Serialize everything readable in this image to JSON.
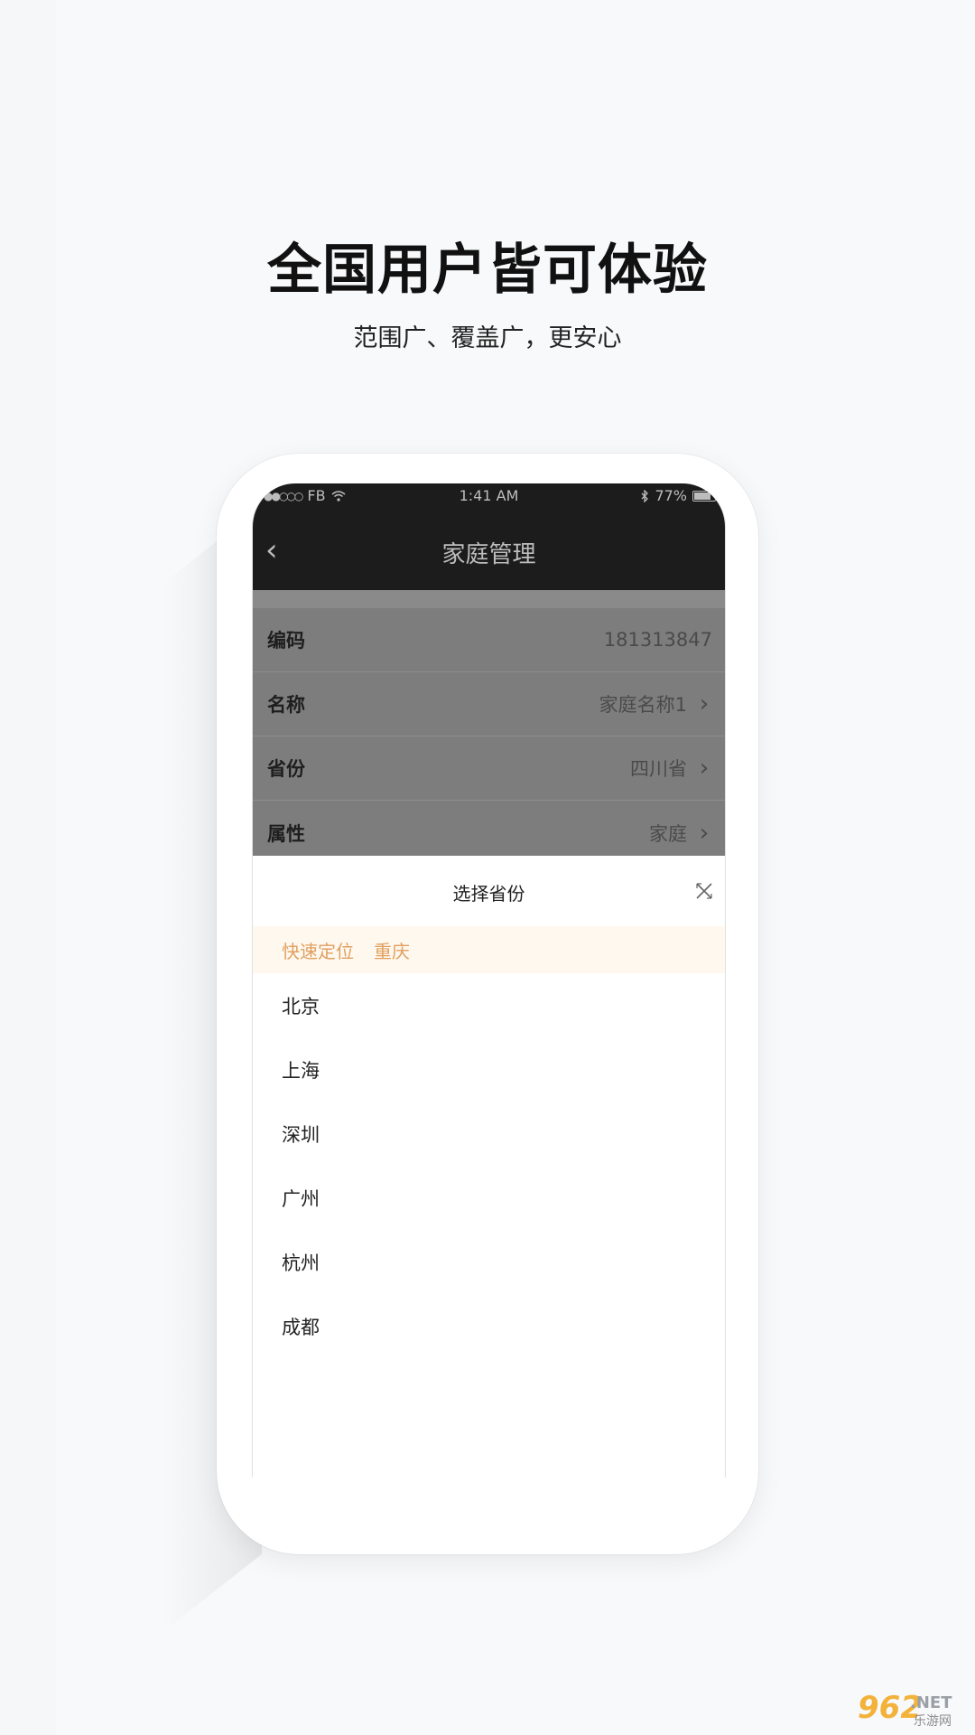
{
  "promo": {
    "headline": "全国用户皆可体验",
    "subline": "范围广、覆盖广，更安心"
  },
  "statusbar": {
    "carrier": "FB",
    "time": "1:41 AM",
    "battery": "77%"
  },
  "navbar": {
    "back_glyph": "‹",
    "title": "家庭管理"
  },
  "form": {
    "rows": [
      {
        "label": "编码",
        "value": "181313847"
      },
      {
        "label": "名称",
        "value": "家庭名称1"
      },
      {
        "label": "省份",
        "value": "四川省"
      },
      {
        "label": "属性",
        "value": "家庭"
      }
    ]
  },
  "sheet": {
    "title": "选择省份",
    "quick_label": "快速定位",
    "quick_city": "重庆",
    "cities": [
      "北京",
      "上海",
      "深圳",
      "广州",
      "杭州",
      "成都"
    ]
  },
  "watermark": {
    "num": "962",
    "net": ".NET",
    "cn": "乐游网"
  },
  "colors": {
    "accent": "#e0a060",
    "dark_bar": "#1c1c1c",
    "overlay": "#7d7d7d"
  }
}
